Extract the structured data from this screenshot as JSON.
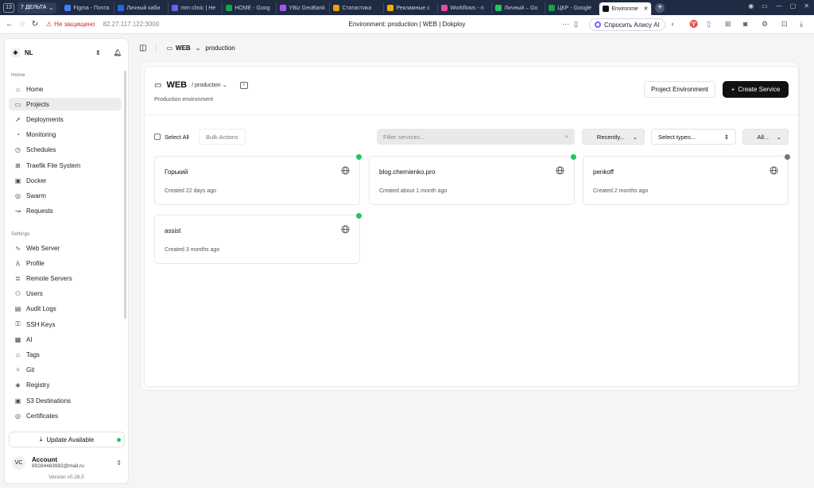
{
  "browser": {
    "tab_count": "13",
    "tab_group": "7 ДЕЛЬТА",
    "tabs": [
      {
        "label": "Figma - Почта",
        "color": "#3b82f6"
      },
      {
        "label": "Личный каби",
        "color": "#2563eb"
      },
      {
        "label": "mm clinic | Не",
        "color": "#6366f1"
      },
      {
        "label": "HOME - Goog",
        "color": "#16a34a"
      },
      {
        "label": "YBiz GeoBank",
        "color": "#a855f7"
      },
      {
        "label": "Статистика",
        "color": "#f59e0b"
      },
      {
        "label": "Рекламные с",
        "color": "#eab308"
      },
      {
        "label": "Workflows - n",
        "color": "#ec4899"
      },
      {
        "label": "Личный – Go",
        "color": "#22c55e"
      },
      {
        "label": "ЦКР - Google",
        "color": "#16a34a"
      },
      {
        "label": "Environme",
        "color": "#111111"
      }
    ],
    "insecure_label": "Не защищено",
    "url": "82.27.117.122:3000",
    "page_title": "Environment: production | WEB | Dokploy",
    "alice_label": "Спросить Алису AI"
  },
  "sidebar": {
    "org": "NL",
    "home_section": "Home",
    "home_items": [
      {
        "label": "Home",
        "icon": "⌂"
      },
      {
        "label": "Projects",
        "icon": "▭"
      },
      {
        "label": "Deployments",
        "icon": "➚"
      },
      {
        "label": "Monitoring",
        "icon": "◔"
      },
      {
        "label": "Schedules",
        "icon": "◷"
      },
      {
        "label": "Traefik File System",
        "icon": "⊞"
      },
      {
        "label": "Docker",
        "icon": "▣"
      },
      {
        "label": "Swarm",
        "icon": "◎"
      },
      {
        "label": "Requests",
        "icon": "↝"
      }
    ],
    "settings_section": "Settings",
    "settings_items": [
      {
        "label": "Web Server",
        "icon": "∿"
      },
      {
        "label": "Profile",
        "icon": "♙"
      },
      {
        "label": "Remote Servers",
        "icon": "≣"
      },
      {
        "label": "Users",
        "icon": "⚇"
      },
      {
        "label": "Audit Logs",
        "icon": "▤"
      },
      {
        "label": "SSH Keys",
        "icon": "⚿"
      },
      {
        "label": "AI",
        "icon": "▦"
      },
      {
        "label": "Tags",
        "icon": "⌂"
      },
      {
        "label": "Git",
        "icon": "⑂"
      },
      {
        "label": "Registry",
        "icon": "◈"
      },
      {
        "label": "S3 Destinations",
        "icon": "▣"
      },
      {
        "label": "Certificates",
        "icon": "◎"
      }
    ],
    "update_label": "Update Available",
    "account_initials": "VC",
    "account_label": "Account",
    "account_email": "89284483992@mail.ru",
    "version": "Version v0.28.5"
  },
  "header": {
    "project": "WEB",
    "environment": "production"
  },
  "main": {
    "title": "WEB",
    "env_select": "/ production",
    "description": "Production environment",
    "project_env_button": "Project Environment",
    "create_service_button": "Create Service",
    "select_all": "Select All",
    "bulk_actions": "Bulk Actions",
    "filter_placeholder": "Filter services...",
    "sort_select": "Recently...",
    "type_select": "Select types...",
    "all_select": "All...",
    "services": [
      {
        "name": "Горький",
        "created": "Created 22 days ago",
        "status_color": "#22c55e"
      },
      {
        "name": "blog.chernienko.pro",
        "created": "Created about 1 month ago",
        "status_color": "#22c55e"
      },
      {
        "name": "penkoff",
        "created": "Created 2 months ago",
        "status_color": "#6b7280"
      },
      {
        "name": "assist",
        "created": "Created 3 months ago",
        "status_color": "#22c55e"
      }
    ]
  }
}
